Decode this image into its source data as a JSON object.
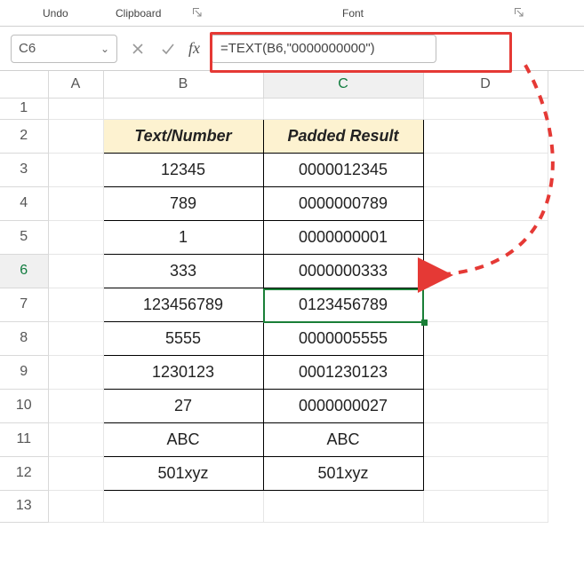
{
  "ribbon": {
    "undo": "Undo",
    "clipboard": "Clipboard",
    "font": "Font"
  },
  "name_box": {
    "value": "C6"
  },
  "fx_label": "fx",
  "formula": "=TEXT(B6,\"0000000000\")",
  "columns": {
    "A": "A",
    "B": "B",
    "C": "C",
    "D": "D"
  },
  "rows": {
    "r1": "1",
    "r2": "2",
    "r3": "3",
    "r4": "4",
    "r5": "5",
    "r6": "6",
    "r7": "7",
    "r8": "8",
    "r9": "9",
    "r10": "10",
    "r11": "11",
    "r12": "12",
    "r13": "13"
  },
  "headers": {
    "b": "Text/Number",
    "c": "Padded Result"
  },
  "data": {
    "b3": "12345",
    "c3": "0000012345",
    "b4": "789",
    "c4": "0000000789",
    "b5": "1",
    "c5": "0000000001",
    "b6": "333",
    "c6": "0000000333",
    "b7": "123456789",
    "c7": "0123456789",
    "b8": "5555",
    "c8": "0000005555",
    "b9": "1230123",
    "c9": "0001230123",
    "b10": "27",
    "c10": "0000000027",
    "b11": "ABC",
    "c11": "ABC",
    "b12": "501xyz",
    "c12": "501xyz"
  }
}
